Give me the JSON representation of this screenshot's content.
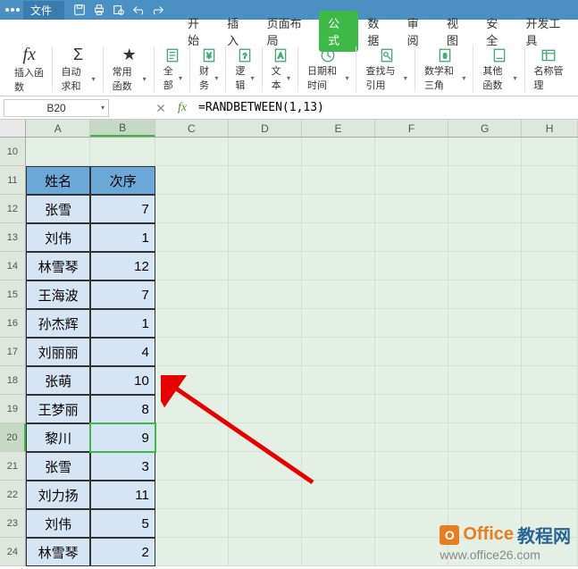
{
  "menu": {
    "file": "文件"
  },
  "tabs": {
    "start": "开始",
    "insert": "插入",
    "layout": "页面布局",
    "formula": "公式",
    "data": "数据",
    "review": "审阅",
    "view": "视图",
    "security": "安全",
    "dev": "开发工具"
  },
  "ribbon": {
    "insert_fn": "插入函数",
    "autosum": "自动求和",
    "common": "常用函数",
    "all": "全部",
    "finance": "财务",
    "logic": "逻辑",
    "text": "文本",
    "datetime": "日期和时间",
    "lookup": "查找与引用",
    "math": "数学和三角",
    "other": "其他函数",
    "name_mgr": "名称管理"
  },
  "cellRef": "B20",
  "formula": "=RANDBETWEEN(1,13)",
  "columns": [
    "A",
    "B",
    "C",
    "D",
    "E",
    "F",
    "G",
    "H"
  ],
  "rows": [
    "10",
    "11",
    "12",
    "13",
    "14",
    "15",
    "16",
    "17",
    "18",
    "19",
    "20",
    "21",
    "22",
    "23",
    "24"
  ],
  "table": {
    "headers": {
      "name": "姓名",
      "order": "次序"
    },
    "data": [
      {
        "name": "张雪",
        "val": "7"
      },
      {
        "name": "刘伟",
        "val": "1"
      },
      {
        "name": "林雪琴",
        "val": "12"
      },
      {
        "name": "王海波",
        "val": "7"
      },
      {
        "name": "孙杰辉",
        "val": "1"
      },
      {
        "name": "刘丽丽",
        "val": "4"
      },
      {
        "name": "张萌",
        "val": "10"
      },
      {
        "name": "王梦丽",
        "val": "8"
      },
      {
        "name": "黎川",
        "val": "9"
      },
      {
        "name": "张雪",
        "val": "3"
      },
      {
        "name": "刘力扬",
        "val": "11"
      },
      {
        "name": "刘伟",
        "val": "5"
      },
      {
        "name": "林雪琴",
        "val": "2"
      }
    ]
  },
  "activeRow": 20,
  "watermark": {
    "brand1": "Office",
    "brand2": "教程网",
    "url": "www.office26.com"
  }
}
